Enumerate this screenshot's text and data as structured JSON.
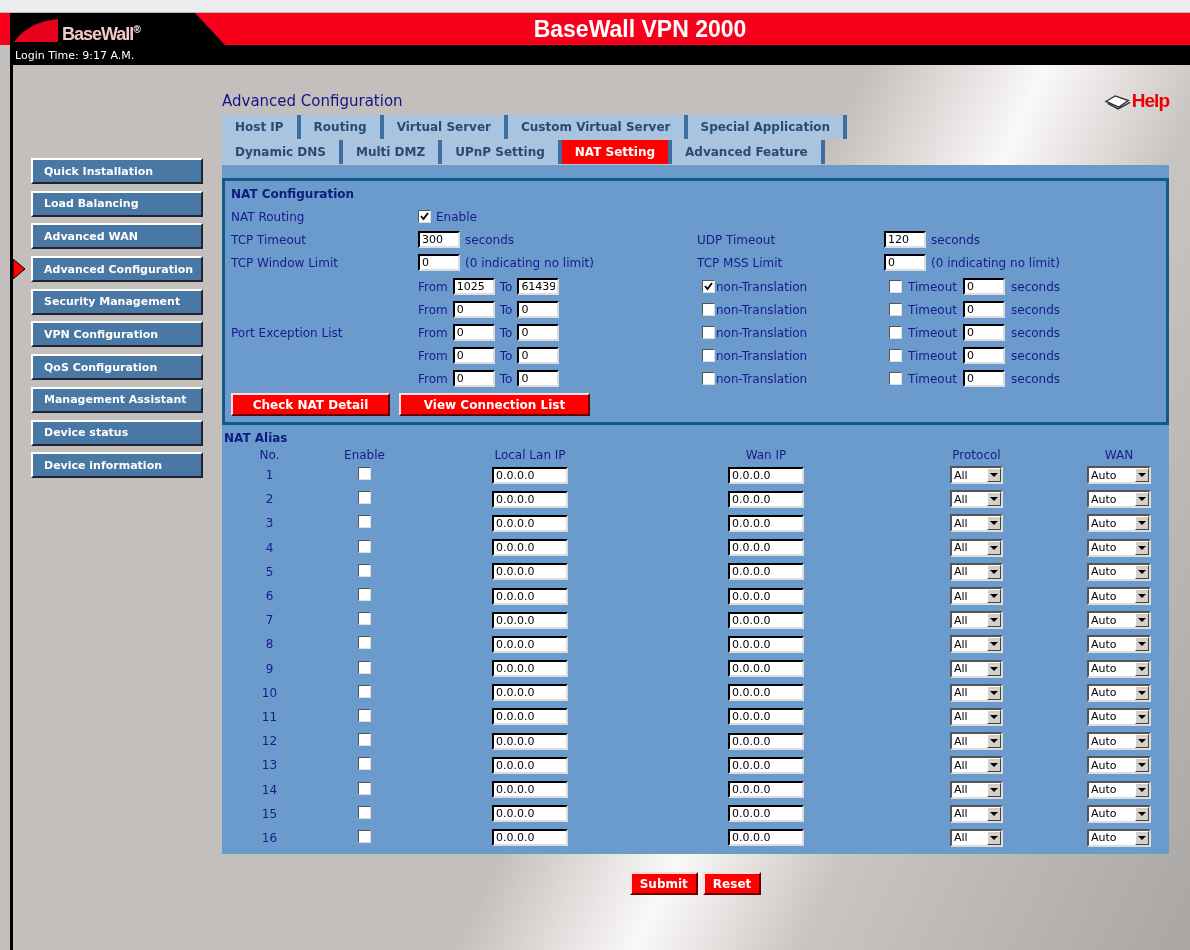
{
  "header": {
    "logo": "BaseWall$^{®}$",
    "title": "BaseWall VPN 2000",
    "login_time": "Login Time: 9:17 A.M."
  },
  "sidebar": {
    "items": [
      {
        "label": "Quick Installation",
        "selected": false
      },
      {
        "label": "Load Balancing",
        "selected": false
      },
      {
        "label": "Advanced WAN",
        "selected": false
      },
      {
        "label": "Advanced Configuration",
        "selected": true
      },
      {
        "label": "Security Management",
        "selected": false
      },
      {
        "label": "VPN Configuration",
        "selected": false
      },
      {
        "label": "QoS Configuration",
        "selected": false
      },
      {
        "label": "Management Assistant",
        "selected": false
      },
      {
        "label": "Device status",
        "selected": false
      },
      {
        "label": "Device information",
        "selected": false
      }
    ]
  },
  "page_title": "Advanced Configuration",
  "help": "Help",
  "tab_rows": [
    [
      {
        "label": "Host IP",
        "selected": false
      },
      {
        "label": "Routing",
        "selected": false
      },
      {
        "label": "Virtual Server",
        "selected": false
      },
      {
        "label": "Custom Virtual Server",
        "selected": false
      },
      {
        "label": "Special Application",
        "selected": false
      }
    ],
    [
      {
        "label": "Dynamic DNS",
        "selected": false
      },
      {
        "label": "Multi DMZ",
        "selected": false
      },
      {
        "label": "UPnP Setting",
        "selected": false
      },
      {
        "label": "NAT Setting",
        "selected": true
      },
      {
        "label": "Advanced Feature",
        "selected": false
      }
    ]
  ],
  "nat_config": {
    "title": "NAT Configuration",
    "nat_routing": {
      "label": "NAT Routing",
      "checked": true,
      "option": "Enable"
    },
    "tcp_timeout": {
      "label": "TCP Timeout",
      "value": "300",
      "unit": "seconds"
    },
    "udp_timeout": {
      "label": "UDP Timeout",
      "value": "120",
      "unit": "seconds"
    },
    "tcp_window_limit": {
      "label": "TCP Window Limit",
      "value": "0",
      "note": "(0 indicating no limit)"
    },
    "tcp_mss_limit": {
      "label": "TCP MSS Limit",
      "value": "0",
      "note": "(0 indicating no limit)"
    },
    "port_exception": {
      "label": "Port Exception List",
      "rows": [
        {
          "from_label": "From",
          "from": "1025",
          "to_label": "To",
          "to": "61439",
          "non_translation": true,
          "nt_label": "non-Translation",
          "timeout_checked": false,
          "timeout_label": "Timeout",
          "timeout": "0",
          "unit": "seconds"
        },
        {
          "from_label": "From",
          "from": "0",
          "to_label": "To",
          "to": "0",
          "non_translation": false,
          "nt_label": "non-Translation",
          "timeout_checked": false,
          "timeout_label": "Timeout",
          "timeout": "0",
          "unit": "seconds"
        },
        {
          "from_label": "From",
          "from": "0",
          "to_label": "To",
          "to": "0",
          "non_translation": false,
          "nt_label": "non-Translation",
          "timeout_checked": false,
          "timeout_label": "Timeout",
          "timeout": "0",
          "unit": "seconds"
        },
        {
          "from_label": "From",
          "from": "0",
          "to_label": "To",
          "to": "0",
          "non_translation": false,
          "nt_label": "non-Translation",
          "timeout_checked": false,
          "timeout_label": "Timeout",
          "timeout": "0",
          "unit": "seconds"
        },
        {
          "from_label": "From",
          "from": "0",
          "to_label": "To",
          "to": "0",
          "non_translation": false,
          "nt_label": "non-Translation",
          "timeout_checked": false,
          "timeout_label": "Timeout",
          "timeout": "0",
          "unit": "seconds"
        }
      ]
    },
    "buttons": [
      "Check NAT Detail",
      "View Connection List"
    ]
  },
  "nat_alias": {
    "title": "NAT Alias",
    "columns": [
      "No.",
      "Enable",
      "Local Lan IP",
      "Wan IP",
      "Protocol",
      "WAN"
    ],
    "rows": [
      {
        "no": "1",
        "enabled": false,
        "local_ip": "0.0.0.0",
        "wan_ip": "0.0.0.0",
        "protocol": "All",
        "wan": "Auto"
      },
      {
        "no": "2",
        "enabled": false,
        "local_ip": "0.0.0.0",
        "wan_ip": "0.0.0.0",
        "protocol": "All",
        "wan": "Auto"
      },
      {
        "no": "3",
        "enabled": false,
        "local_ip": "0.0.0.0",
        "wan_ip": "0.0.0.0",
        "protocol": "All",
        "wan": "Auto"
      },
      {
        "no": "4",
        "enabled": false,
        "local_ip": "0.0.0.0",
        "wan_ip": "0.0.0.0",
        "protocol": "All",
        "wan": "Auto"
      },
      {
        "no": "5",
        "enabled": false,
        "local_ip": "0.0.0.0",
        "wan_ip": "0.0.0.0",
        "protocol": "All",
        "wan": "Auto"
      },
      {
        "no": "6",
        "enabled": false,
        "local_ip": "0.0.0.0",
        "wan_ip": "0.0.0.0",
        "protocol": "All",
        "wan": "Auto"
      },
      {
        "no": "7",
        "enabled": false,
        "local_ip": "0.0.0.0",
        "wan_ip": "0.0.0.0",
        "protocol": "All",
        "wan": "Auto"
      },
      {
        "no": "8",
        "enabled": false,
        "local_ip": "0.0.0.0",
        "wan_ip": "0.0.0.0",
        "protocol": "All",
        "wan": "Auto"
      },
      {
        "no": "9",
        "enabled": false,
        "local_ip": "0.0.0.0",
        "wan_ip": "0.0.0.0",
        "protocol": "All",
        "wan": "Auto"
      },
      {
        "no": "10",
        "enabled": false,
        "local_ip": "0.0.0.0",
        "wan_ip": "0.0.0.0",
        "protocol": "All",
        "wan": "Auto"
      },
      {
        "no": "11",
        "enabled": false,
        "local_ip": "0.0.0.0",
        "wan_ip": "0.0.0.0",
        "protocol": "All",
        "wan": "Auto"
      },
      {
        "no": "12",
        "enabled": false,
        "local_ip": "0.0.0.0",
        "wan_ip": "0.0.0.0",
        "protocol": "All",
        "wan": "Auto"
      },
      {
        "no": "13",
        "enabled": false,
        "local_ip": "0.0.0.0",
        "wan_ip": "0.0.0.0",
        "protocol": "All",
        "wan": "Auto"
      },
      {
        "no": "14",
        "enabled": false,
        "local_ip": "0.0.0.0",
        "wan_ip": "0.0.0.0",
        "protocol": "All",
        "wan": "Auto"
      },
      {
        "no": "15",
        "enabled": false,
        "local_ip": "0.0.0.0",
        "wan_ip": "0.0.0.0",
        "protocol": "All",
        "wan": "Auto"
      },
      {
        "no": "16",
        "enabled": false,
        "local_ip": "0.0.0.0",
        "wan_ip": "0.0.0.0",
        "protocol": "All",
        "wan": "Auto"
      }
    ]
  },
  "actions": [
    "Submit",
    "Reset"
  ]
}
